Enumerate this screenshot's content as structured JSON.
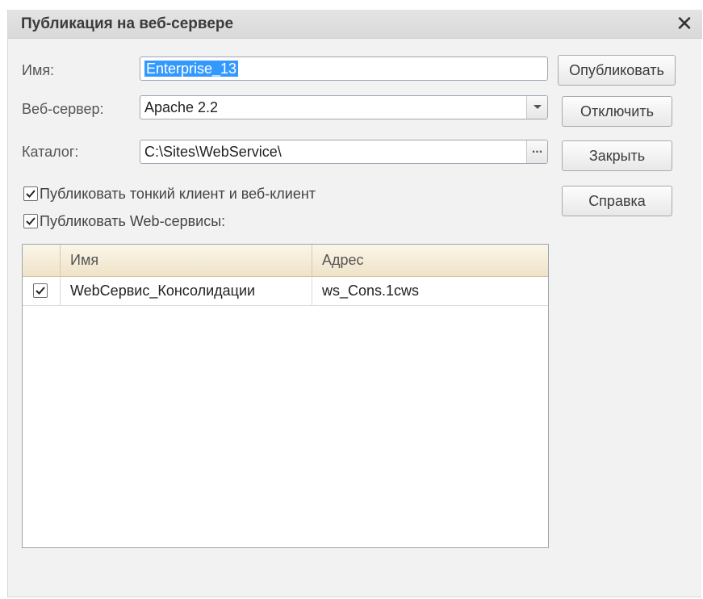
{
  "dialog": {
    "title": "Публикация на веб-сервере",
    "close_label": "✕"
  },
  "form": {
    "name_label": "Имя:",
    "name_value": "Enterprise_13",
    "webserver_label": "Веб-сервер:",
    "webserver_value": "Apache 2.2",
    "catalog_label": "Каталог:",
    "catalog_value": "C:\\Sites\\WebService\\",
    "catalog_button": "..."
  },
  "checkboxes": {
    "thin_client_label": "Публиковать тонкий клиент и веб-клиент",
    "thin_client_checked": true,
    "webservices_label": "Публиковать Web-сервисы:",
    "webservices_checked": true
  },
  "buttons": {
    "publish": "Опубликовать",
    "disable": "Отключить",
    "close": "Закрыть",
    "help": "Справка"
  },
  "services_table": {
    "columns": [
      "",
      "Имя",
      "Адрес"
    ],
    "rows": [
      {
        "checked": true,
        "name": "WebСервис_Консолидации",
        "address": "ws_Cons.1cws"
      }
    ]
  }
}
